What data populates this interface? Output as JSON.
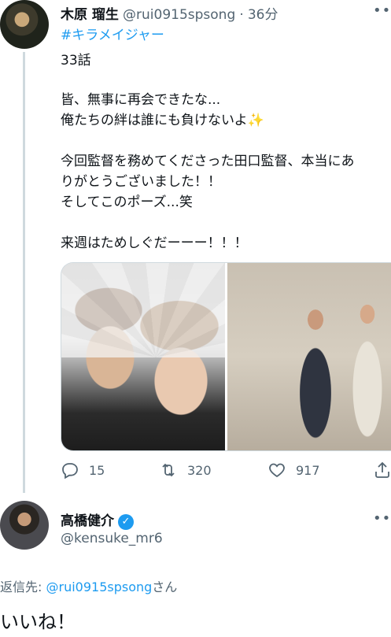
{
  "tweet": {
    "author_name": "木原 瑠生",
    "author_handle": "@rui0915spsong",
    "separator": "·",
    "time": "36分",
    "more": "•••",
    "hashtag": "#キラメイジャー",
    "lines": [
      "33話",
      "皆、無事に再会できたな...",
      "俺たちの絆は誰にも負けないよ",
      "今回監督を務めてくださった田口監督、本当にあ",
      "りがとうございました！！",
      "そしてこのポーズ...笑",
      "来週はためしぐだーーー！！！"
    ],
    "sparkle": "✨",
    "reply_count": "15",
    "retweet_count": "320",
    "like_count": "917"
  },
  "reply": {
    "author_name": "高橋健介",
    "verified_mark": "✓",
    "author_handle": "@kensuke_mr6",
    "more": "•••",
    "reply_to_prefix": "返信先: ",
    "reply_to_handle": "@rui0915spsong",
    "reply_to_suffix": "さん",
    "text": "いいね！"
  },
  "colors": {
    "link": "#1d9bf0",
    "secondary_text": "#536471",
    "text": "#0f1419",
    "thread_line": "#cfd9de"
  },
  "icons": [
    "reply-icon",
    "retweet-icon",
    "like-icon",
    "share-icon",
    "verified-badge-icon",
    "more-icon"
  ]
}
